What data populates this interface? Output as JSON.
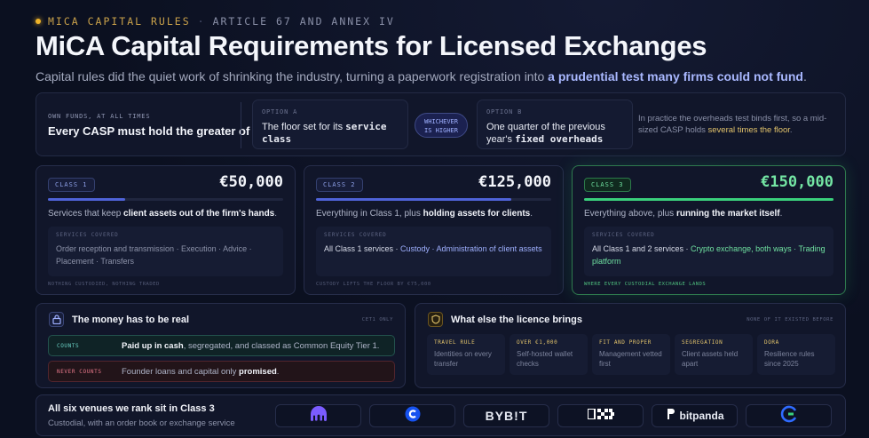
{
  "eyebrow": {
    "primary": "MICA CAPITAL RULES",
    "separator": "·",
    "secondary": "ARTICLE 67 AND ANNEX IV"
  },
  "title": "MiCA Capital Requirements for Licensed Exchanges",
  "subtitle": {
    "lead": "Capital rules did the quiet work of shrinking the industry, turning a paperwork registration into ",
    "highlight": "a prudential test many firms could not fund",
    "tail": "."
  },
  "rule": {
    "caption": "OWN FUNDS, AT ALL TIMES",
    "lead": "Every CASP must hold the greater of",
    "option_a": {
      "label": "OPTION A",
      "text": "The floor set for its ",
      "code": "service class"
    },
    "pill": [
      "WHICHEVER",
      "IS HIGHER"
    ],
    "option_b": {
      "label": "OPTION B",
      "text": "One quarter of the previous year's ",
      "code": "fixed overheads"
    },
    "note": {
      "lead": "In practice the overheads test binds first, so a mid-sized CASP holds ",
      "highlight": "several times the floor",
      "tail": "."
    }
  },
  "classes": [
    {
      "badge": "CLASS 1",
      "amount": "€50,000",
      "bar_fraction": 0.33,
      "desc_lead": "Services that keep ",
      "desc_bold": "client assets out of the firm's hands",
      "desc_tail": ".",
      "services_caption": "SERVICES COVERED",
      "services_text": "Order reception and transmission · Execution · Advice · Placement · Transfers",
      "footer": "NOTHING CUSTODIED, NOTHING TRADED"
    },
    {
      "badge": "CLASS 2",
      "amount": "€125,000",
      "bar_fraction": 0.83,
      "desc_lead": "Everything in Class 1, plus ",
      "desc_bold": "holding assets for clients",
      "desc_tail": ".",
      "services_caption": "SERVICES COVERED",
      "services_plain": "All Class 1 services · ",
      "services_highlight": "Custody · Administration of client assets",
      "footer": "CUSTODY LIFTS THE FLOOR BY €75,000"
    },
    {
      "badge": "CLASS 3",
      "amount": "€150,000",
      "bar_fraction": 1.0,
      "desc_lead": "Everything above, plus ",
      "desc_bold": "running the market itself",
      "desc_tail": ".",
      "services_caption": "SERVICES COVERED",
      "services_plain": "All Class 1 and 2 services · ",
      "services_highlight": "Crypto exchange, both ways · Trading platform",
      "footer": "WHERE EVERY CUSTODIAL EXCHANGE LANDS"
    }
  ],
  "money": {
    "icon": "lock-icon",
    "title": "The money has to be real",
    "meta": "CET1 ONLY",
    "counts": {
      "label": "COUNTS",
      "bold": "Paid up in cash",
      "text": ", segregated, and classed as Common Equity Tier 1."
    },
    "never": {
      "label": "NEVER COUNTS",
      "text": "Founder loans and capital only ",
      "bold": "promised",
      "tail": "."
    }
  },
  "licence": {
    "icon": "shield-icon",
    "title": "What else the licence brings",
    "meta": "NONE OF IT EXISTED BEFORE",
    "tiles": [
      {
        "title": "TRAVEL RULE",
        "desc": "Identities on every transfer"
      },
      {
        "title": "OVER €1,000",
        "desc": "Self-hosted wallet checks"
      },
      {
        "title": "FIT AND PROPER",
        "desc": "Management vetted first"
      },
      {
        "title": "SEGREGATION",
        "desc": "Client assets held apart"
      },
      {
        "title": "DORA",
        "desc": "Resilience rules since 2025"
      }
    ]
  },
  "venues": {
    "title": "All six venues we rank sit in Class 3",
    "subtitle": "Custodial, with an order book or exchange service",
    "logos": [
      {
        "icon": "kraken-logo-icon",
        "text": ""
      },
      {
        "icon": "coinbase-logo-icon",
        "text": ""
      },
      {
        "icon": "bybit-logo-icon",
        "text": "BYB!T"
      },
      {
        "icon": "okx-logo-icon",
        "text": ""
      },
      {
        "icon": "bitpanda-logo-icon",
        "text": "bitpanda"
      },
      {
        "icon": "crypto-com-logo-icon",
        "text": ""
      }
    ]
  },
  "colors": {
    "background": "#0b1020",
    "accent_blue": "#4f63d8",
    "accent_green": "#3ad07c",
    "accent_gold": "#e2c36b",
    "danger": "#e8788a"
  }
}
